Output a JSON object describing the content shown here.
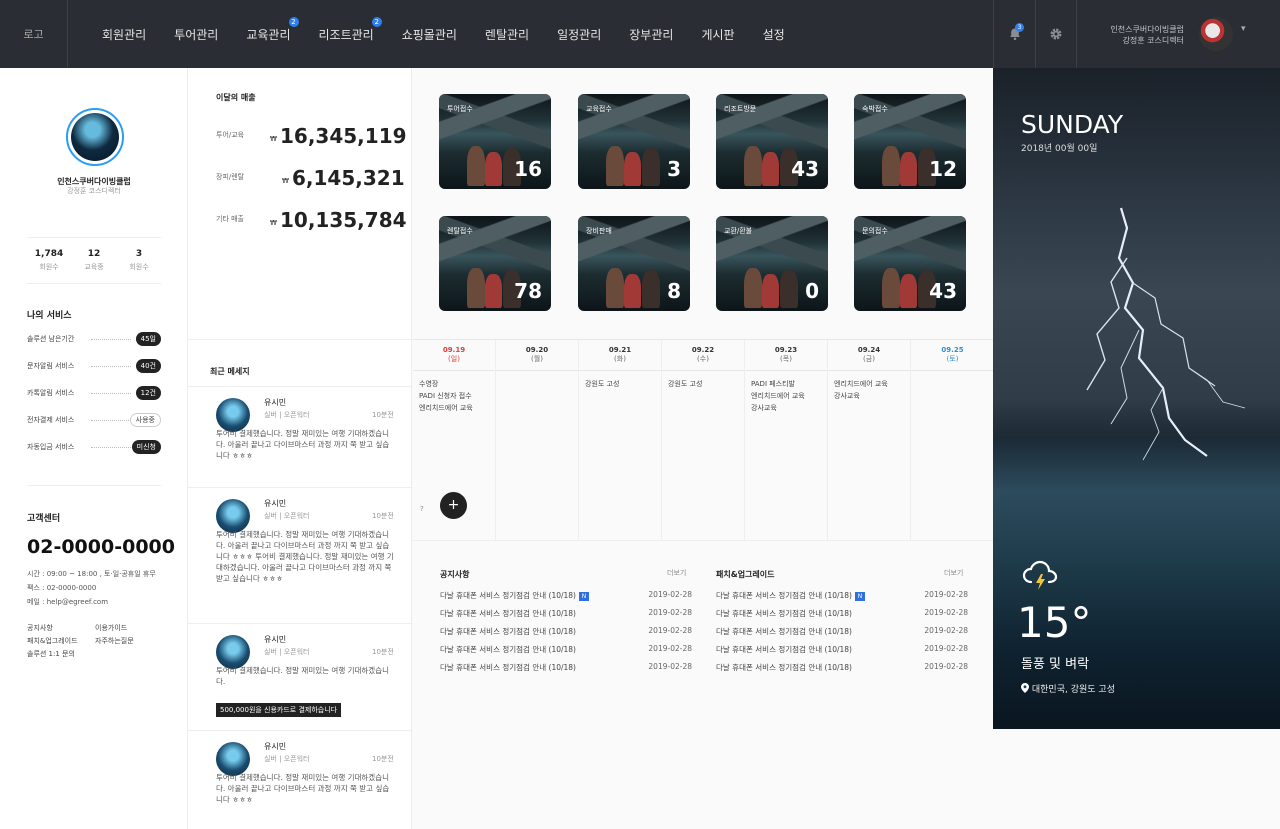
{
  "header": {
    "logo": "로고",
    "nav": [
      {
        "label": "회원관리"
      },
      {
        "label": "투어관리"
      },
      {
        "label": "교육관리",
        "badge": "2"
      },
      {
        "label": "리조트관리",
        "badge": "2"
      },
      {
        "label": "쇼핑몰관리"
      },
      {
        "label": "렌탈관리"
      },
      {
        "label": "일정관리"
      },
      {
        "label": "장부관리"
      },
      {
        "label": "게시판"
      },
      {
        "label": "설정"
      }
    ],
    "notification_count": "3",
    "user_org": "인천스쿠버다이빙클럽",
    "user_name": "강정훈 코스디렉터"
  },
  "profile": {
    "name": "인천스쿠버다이빙클럽",
    "role": "강정훈 코스디렉터",
    "stats": [
      {
        "value": "1,784",
        "label": "회원수"
      },
      {
        "value": "12",
        "label": "교육중"
      },
      {
        "value": "3",
        "label": "회원수"
      }
    ]
  },
  "services": {
    "title": "나의 서비스",
    "items": [
      {
        "label": "솔루션 남은기간",
        "value": "45일",
        "style": "dark"
      },
      {
        "label": "문자알림 서비스",
        "value": "40건",
        "style": "dark"
      },
      {
        "label": "카톡알림 서비스",
        "value": "12건",
        "style": "dark"
      },
      {
        "label": "전자결제 서비스",
        "value": "사용중",
        "style": "outline"
      },
      {
        "label": "자동입금 서비스",
        "value": "미신청",
        "style": "dark"
      }
    ]
  },
  "support": {
    "title": "고객센터",
    "phone": "02-0000-0000",
    "hours": "시간 : 09:00 ~ 18:00 , 토·일·공휴일 휴무",
    "fax": "팩스 : 02-0000-0000",
    "email": "메일 : help@egreef.com",
    "links": [
      "공지사항",
      "이용가이드",
      "패치&업그레이드",
      "자주하는질문",
      "솔루션 1:1 문의"
    ]
  },
  "revenue": {
    "title": "이달의 매출",
    "currency": "₩",
    "rows": [
      {
        "label": "투어/교육",
        "value": "16,345,119"
      },
      {
        "label": "장피/렌탈",
        "value": "6,145,321"
      },
      {
        "label": "기타 매출",
        "value": "10,135,784"
      }
    ]
  },
  "messages": {
    "title": "최근 메세지",
    "items": [
      {
        "name": "유시민",
        "sub": "실버 | 오픈워터",
        "time": "10분전",
        "body": "투어비 결제했습니다. 정말 재미있는 여행 기대하겠습니다. 아울러 끝나고 다이브마스터 과정 까지 쭉 받고 싶습니다 ㅎㅎㅎ",
        "pill": ""
      },
      {
        "name": "유시민",
        "sub": "실버 | 오픈워터",
        "time": "10분전",
        "body": "투어비 결제했습니다. 정말 재미있는 여행 기대하겠습니다. 아울러 끝나고 다이브마스터 과정 까지 쭉 받고 싶습니다 ㅎㅎㅎ 투어비 결제했습니다. 정말 재미있는 여행 기대하겠습니다. 아울러 끝나고 다이브마스터 과정 까지 쭉 받고 싶습니다 ㅎㅎㅎ",
        "pill": ""
      },
      {
        "name": "유시민",
        "sub": "실버 | 오픈워터",
        "time": "10분전",
        "body": "투어비 결제했습니다. 정말 재미있는 여행 기대하겠습니다.",
        "pill": "500,000원을 신용카드로 결제하습니다"
      },
      {
        "name": "유시민",
        "sub": "실버 | 오픈워터",
        "time": "10분전",
        "body": "투어비 결제했습니다. 정말 재미있는 여행 기대하겠습니다. 아울러 끝나고 다이브마스터 과정 까지 쭉 받고 싶습니다 ㅎㅎㅎ",
        "pill": ""
      }
    ]
  },
  "summary_cards": [
    {
      "title": "투어접수",
      "value": "16"
    },
    {
      "title": "교육접수",
      "value": "3"
    },
    {
      "title": "리조트방문",
      "value": "43"
    },
    {
      "title": "숙박접수",
      "value": "12"
    },
    {
      "title": "렌탈접수",
      "value": "78"
    },
    {
      "title": "장비판매",
      "value": "8"
    },
    {
      "title": "교환/환불",
      "value": "0"
    },
    {
      "title": "문의접수",
      "value": "43"
    }
  ],
  "calendar": {
    "days": [
      {
        "date": "09.19",
        "dow": "(일)",
        "color": "#e53935",
        "items": [
          "수영장",
          "PADI 신청자 접수",
          "엔리치드에어 교육"
        ]
      },
      {
        "date": "09.20",
        "dow": "(월)",
        "color": "#333333",
        "items": []
      },
      {
        "date": "09.21",
        "dow": "(화)",
        "color": "#333333",
        "items": [
          "강원도 고성"
        ]
      },
      {
        "date": "09.22",
        "dow": "(수)",
        "color": "#333333",
        "items": [
          "강원도 고성"
        ]
      },
      {
        "date": "09.23",
        "dow": "(목)",
        "color": "#333333",
        "items": [
          "PADI 페스티발",
          "엔리치드에어 교육",
          "강사교육"
        ]
      },
      {
        "date": "09.24",
        "dow": "(금)",
        "color": "#333333",
        "items": [
          "엔리치드에어 교육",
          "강사교육"
        ]
      },
      {
        "date": "09.25",
        "dow": "(토)",
        "color": "#2f8fd8",
        "items": []
      }
    ],
    "add_label": "+"
  },
  "notices": {
    "title": "공지사항",
    "more": "더보기",
    "new_label": "N",
    "rows": [
      {
        "text": "다날 휴대폰 서비스 정기점검 안내 (10/18)",
        "date": "2019-02-28",
        "isNew": true
      },
      {
        "text": "다날 휴대폰 서비스 정기점검 안내 (10/18)",
        "date": "2019-02-28",
        "isNew": false
      },
      {
        "text": "다날 휴대폰 서비스 정기점검 안내 (10/18)",
        "date": "2019-02-28",
        "isNew": false
      },
      {
        "text": "다날 휴대폰 서비스 정기점검 안내 (10/18)",
        "date": "2019-02-28",
        "isNew": false
      },
      {
        "text": "다날 휴대폰 서비스 정기점검 안내 (10/18)",
        "date": "2019-02-28",
        "isNew": false
      }
    ]
  },
  "patches": {
    "title": "패치&업그레이드",
    "more": "더보기",
    "new_label": "N",
    "rows": [
      {
        "text": "다날 휴대폰 서비스 정기점검 안내 (10/18)",
        "date": "2019-02-28",
        "isNew": true
      },
      {
        "text": "다날 휴대폰 서비스 정기점검 안내 (10/18)",
        "date": "2019-02-28",
        "isNew": false
      },
      {
        "text": "다날 휴대폰 서비스 정기점검 안내 (10/18)",
        "date": "2019-02-28",
        "isNew": false
      },
      {
        "text": "다날 휴대폰 서비스 정기점검 안내 (10/18)",
        "date": "2019-02-28",
        "isNew": false
      },
      {
        "text": "다날 휴대폰 서비스 정기점검 안내 (10/18)",
        "date": "2019-02-28",
        "isNew": false
      }
    ]
  },
  "weather": {
    "day": "SUNDAY",
    "date": "2018년 00월 00일",
    "temp": "15°",
    "desc": "돌풍 및 벼락",
    "location": "대한민국, 강원도 고성",
    "icon": "thunderstorm-icon"
  }
}
